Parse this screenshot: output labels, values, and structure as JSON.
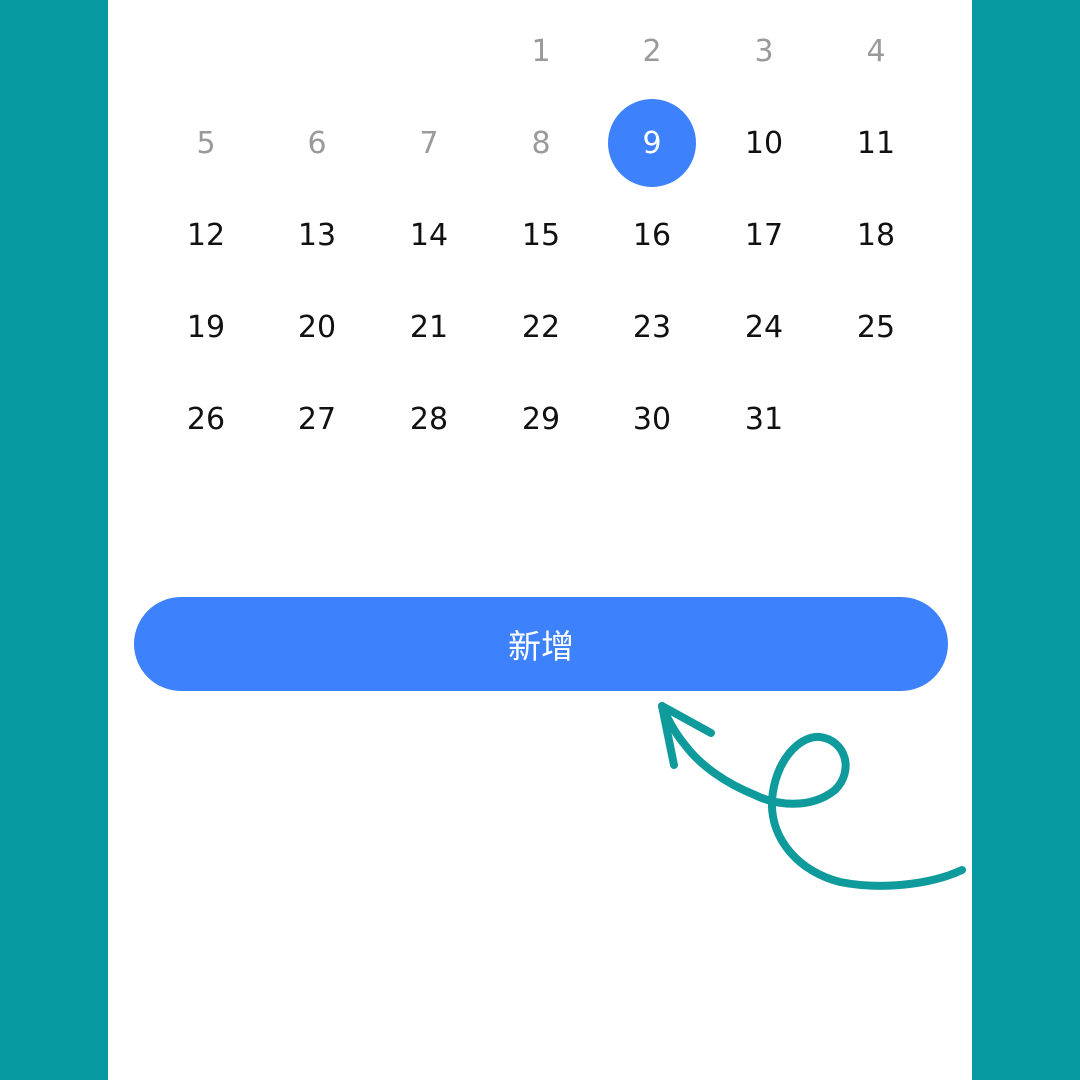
{
  "calendar": {
    "selected_day": "9",
    "weeks": [
      [
        {
          "label": "",
          "state": "empty"
        },
        {
          "label": "",
          "state": "empty"
        },
        {
          "label": "",
          "state": "empty"
        },
        {
          "label": "1",
          "state": "muted"
        },
        {
          "label": "2",
          "state": "muted"
        },
        {
          "label": "3",
          "state": "muted"
        },
        {
          "label": "4",
          "state": "muted"
        }
      ],
      [
        {
          "label": "5",
          "state": "muted"
        },
        {
          "label": "6",
          "state": "muted"
        },
        {
          "label": "7",
          "state": "muted"
        },
        {
          "label": "8",
          "state": "muted"
        },
        {
          "label": "9",
          "state": "selected"
        },
        {
          "label": "10",
          "state": "normal"
        },
        {
          "label": "11",
          "state": "normal"
        }
      ],
      [
        {
          "label": "12",
          "state": "normal"
        },
        {
          "label": "13",
          "state": "normal"
        },
        {
          "label": "14",
          "state": "normal"
        },
        {
          "label": "15",
          "state": "normal"
        },
        {
          "label": "16",
          "state": "normal"
        },
        {
          "label": "17",
          "state": "normal"
        },
        {
          "label": "18",
          "state": "normal"
        }
      ],
      [
        {
          "label": "19",
          "state": "normal"
        },
        {
          "label": "20",
          "state": "normal"
        },
        {
          "label": "21",
          "state": "normal"
        },
        {
          "label": "22",
          "state": "normal"
        },
        {
          "label": "23",
          "state": "normal"
        },
        {
          "label": "24",
          "state": "normal"
        },
        {
          "label": "25",
          "state": "normal"
        }
      ],
      [
        {
          "label": "26",
          "state": "normal"
        },
        {
          "label": "27",
          "state": "normal"
        },
        {
          "label": "28",
          "state": "normal"
        },
        {
          "label": "29",
          "state": "normal"
        },
        {
          "label": "30",
          "state": "normal"
        },
        {
          "label": "31",
          "state": "normal"
        },
        {
          "label": "",
          "state": "empty"
        }
      ]
    ]
  },
  "actions": {
    "add_label": "新增"
  },
  "annotation": {
    "icon": "curly-arrow-icon"
  },
  "colors": {
    "background": "#079aa0",
    "panel": "#ffffff",
    "accent": "#3d82fc",
    "muted_text": "#9a9a9a",
    "text": "#111111",
    "arrow": "#0f9a9c"
  }
}
